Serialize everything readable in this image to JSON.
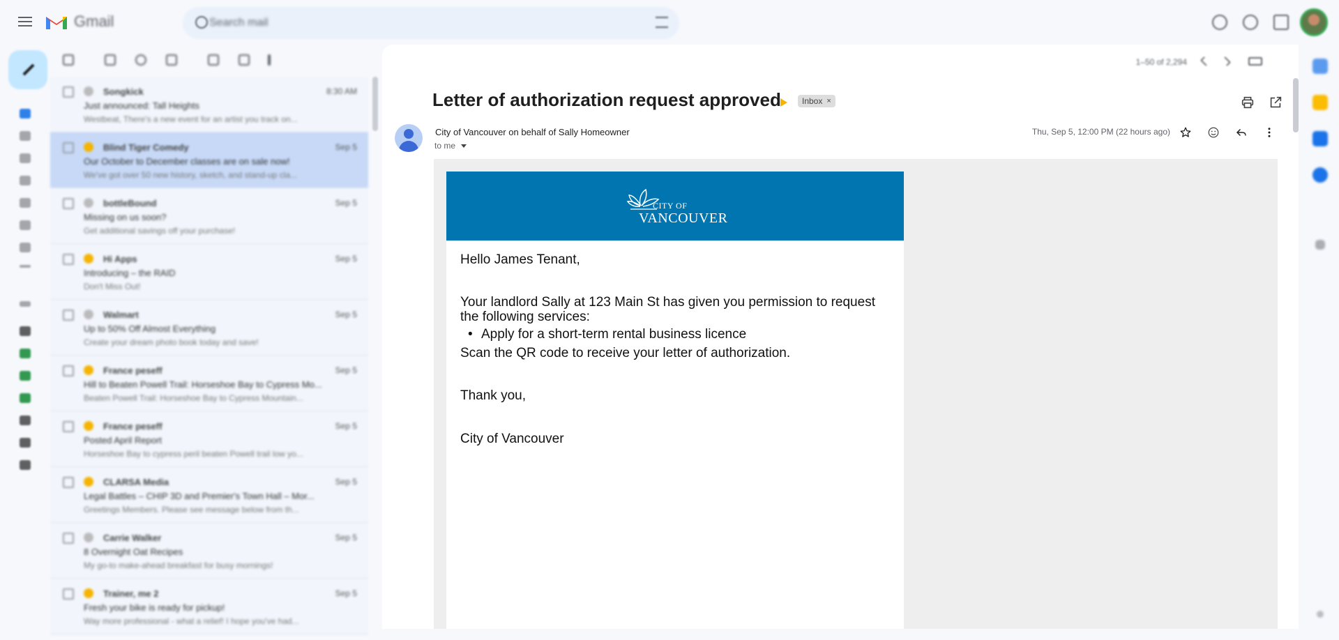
{
  "app": {
    "name": "Gmail",
    "search_placeholder": "Search mail"
  },
  "toolbar": {
    "pagination": "1–50 of 2,294"
  },
  "message_list": [
    {
      "sender": "Songkick",
      "subject": "Just announced: Tall Heights",
      "snippet": "Westbeat, There's a new event for an artist you track on...",
      "date": "8:30 AM",
      "starred": false,
      "selected": false
    },
    {
      "sender": "Blind Tiger Comedy",
      "subject": "Our October to December classes are on sale now!",
      "snippet": "We've got over 50 new history, sketch, and stand-up cla...",
      "date": "Sep 5",
      "starred": true,
      "selected": true
    },
    {
      "sender": "bottleBound",
      "subject": "Missing on us soon?",
      "snippet": "Get additional savings off your purchase!",
      "date": "Sep 5",
      "starred": false,
      "selected": false
    },
    {
      "sender": "Hi Apps",
      "subject": "Introducing – the RAID",
      "snippet": "Don't Miss Out!",
      "date": "Sep 5",
      "starred": true,
      "selected": false
    },
    {
      "sender": "Walmart",
      "subject": "Up to 50% Off Almost Everything",
      "snippet": "Create your dream photo book today and save!",
      "date": "Sep 5",
      "starred": false,
      "selected": false
    },
    {
      "sender": "France peseff",
      "subject": "Hill to Beaten Powell Trail: Horseshoe Bay to Cypress Mo...",
      "snippet": "Beaten Powell Trail: Horseshoe Bay to Cypress Mountain...",
      "date": "Sep 5",
      "starred": true,
      "selected": false
    },
    {
      "sender": "France peseff",
      "subject": "Posted April Report",
      "snippet": "Horseshoe Bay to cypress peril beaten Powell trail low yo...",
      "date": "Sep 5",
      "starred": true,
      "selected": false
    },
    {
      "sender": "CLARSA Media",
      "subject": "Legal Battles – CHIP 3D and Premier's Town Hall – Mor...",
      "snippet": "Greetings Members. Please see message below from th...",
      "date": "Sep 5",
      "starred": true,
      "selected": false
    },
    {
      "sender": "Carrie Walker",
      "subject": "8 Overnight Oat Recipes",
      "snippet": "My go-to make-ahead breakfast for busy mornings!",
      "date": "Sep 5",
      "starred": false,
      "selected": false
    },
    {
      "sender": "Trainer, me 2",
      "subject": "Fresh your bike is ready for pickup!",
      "snippet": "Way more professional - what a relief! I hope you've had...",
      "date": "Sep 5",
      "starred": true,
      "selected": false
    }
  ],
  "email": {
    "subject": "Letter of authorization request approved",
    "label": "Inbox",
    "label_close": "×",
    "from": "City of Vancouver on behalf of Sally Homeowner",
    "to": "to me",
    "datetime": "Thu, Sep 5, 12:00 PM (22 hours ago)",
    "banner": {
      "small": "CITY OF",
      "big": "VANCOUVER",
      "color": "#0075b0"
    },
    "greeting": "Hello James Tenant,",
    "paragraph1": "Your landlord Sally at 123 Main St has given you permission to request the following services:",
    "services": [
      "Apply for a short-term rental business licence"
    ],
    "paragraph2": "Scan the QR code to receive your letter of authorization.",
    "closing": "Thank you,",
    "signature": "City of Vancouver"
  },
  "colors": {
    "accent": "#0b57d0",
    "compose_bg": "#c2e7ff",
    "selected_row": "#c7d9f7",
    "important_marker": "#f4b400"
  },
  "icons": {
    "star": "star-outline-icon",
    "emoji": "emoji-smile-icon",
    "reply": "reply-arrow-icon",
    "more": "more-vert-icon",
    "print": "print-icon",
    "open_new": "open-in-new-icon"
  }
}
